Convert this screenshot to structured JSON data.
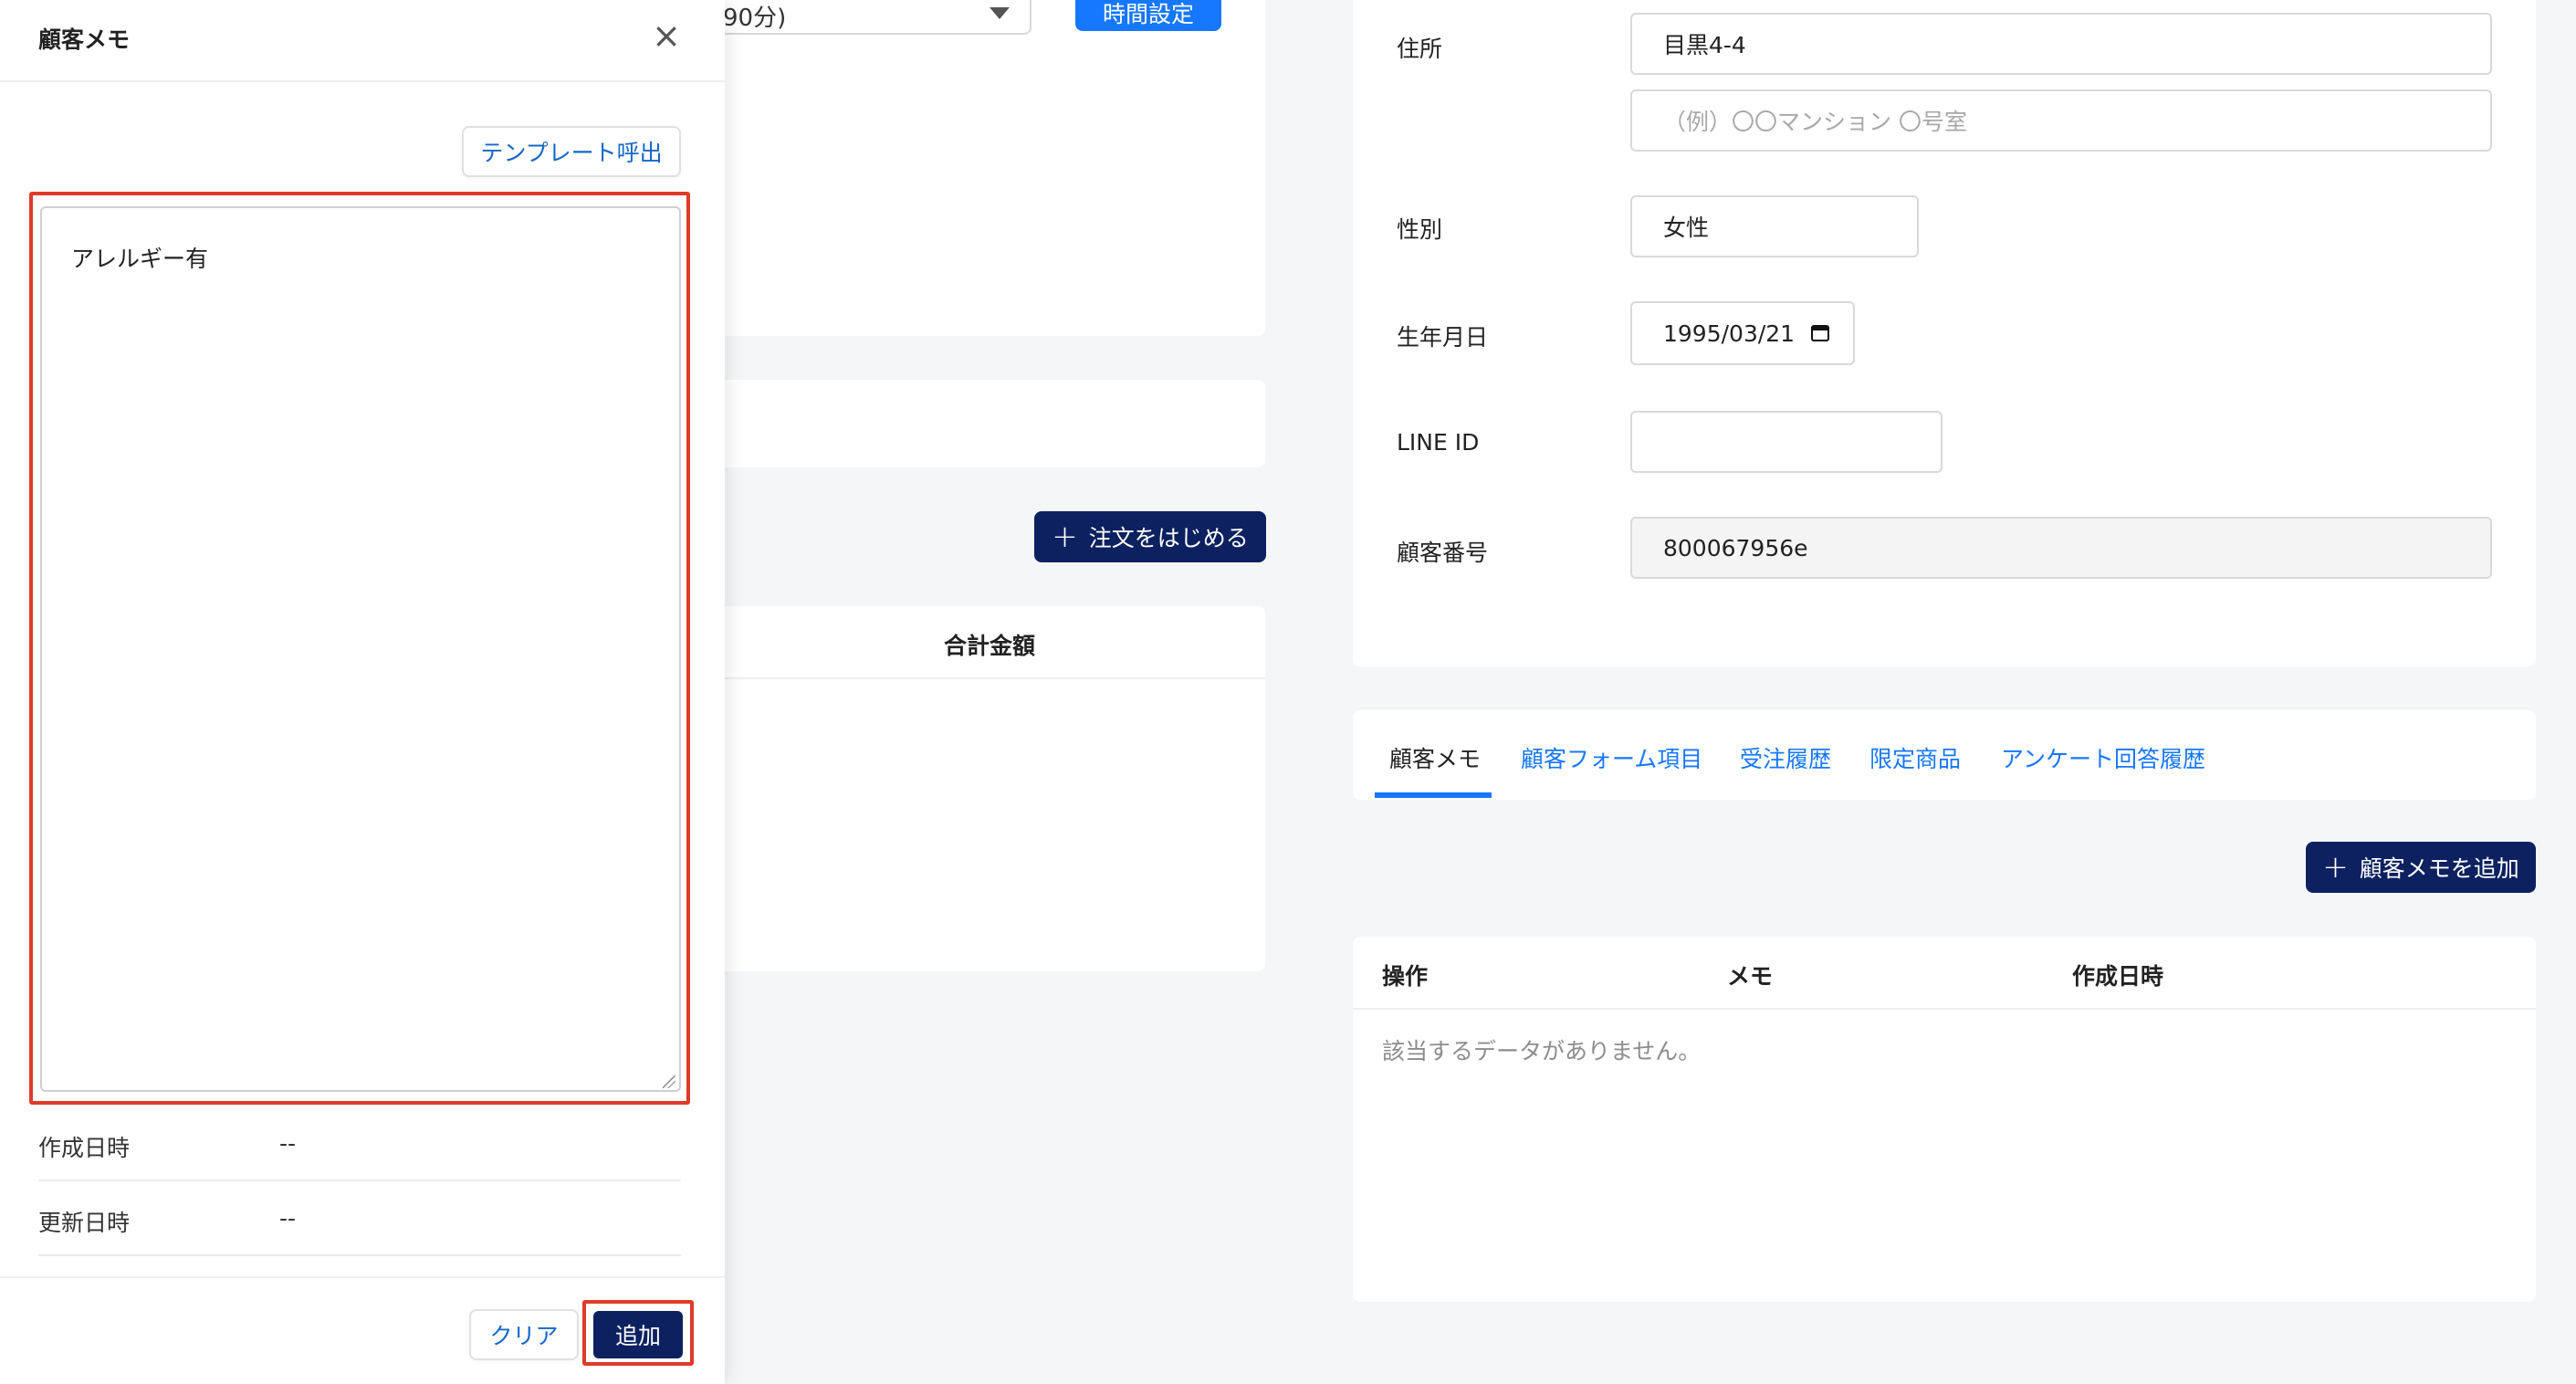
{
  "background_left": {
    "time_select_value": "90分)",
    "time_set_button": "時間設定",
    "start_order_button": "注文をはじめる",
    "order_table_header_total": "合計金額"
  },
  "customer_form": {
    "address_label": "住所",
    "address_value": "目黒4-4",
    "address2_placeholder": "（例）〇〇マンション 〇号室",
    "gender_label": "性別",
    "gender_value": "女性",
    "birthday_label": "生年月日",
    "birthday_value": "1995/03/21",
    "line_id_label": "LINE ID",
    "line_id_value": "",
    "customer_number_label": "顧客番号",
    "customer_number_value": "800067956e"
  },
  "tabs": [
    {
      "label": "顧客メモ",
      "active": true
    },
    {
      "label": "顧客フォーム項目",
      "active": false
    },
    {
      "label": "受注履歴",
      "active": false
    },
    {
      "label": "限定商品",
      "active": false
    },
    {
      "label": "アンケート回答履歴",
      "active": false
    }
  ],
  "memo_list": {
    "add_button": "顧客メモを追加",
    "columns": [
      "操作",
      "メモ",
      "作成日時"
    ],
    "empty_text": "該当するデータがありません。"
  },
  "drawer": {
    "title": "顧客メモ",
    "template_button": "テンプレート呼出",
    "memo_text": "アレルギー有",
    "created_label": "作成日時",
    "created_value": "--",
    "updated_label": "更新日時",
    "updated_value": "--",
    "clear_button": "クリア",
    "add_button": "追加"
  },
  "colors": {
    "accent_blue": "#1677ff",
    "navy": "#0d2160",
    "highlight_red": "#e03a2a"
  }
}
